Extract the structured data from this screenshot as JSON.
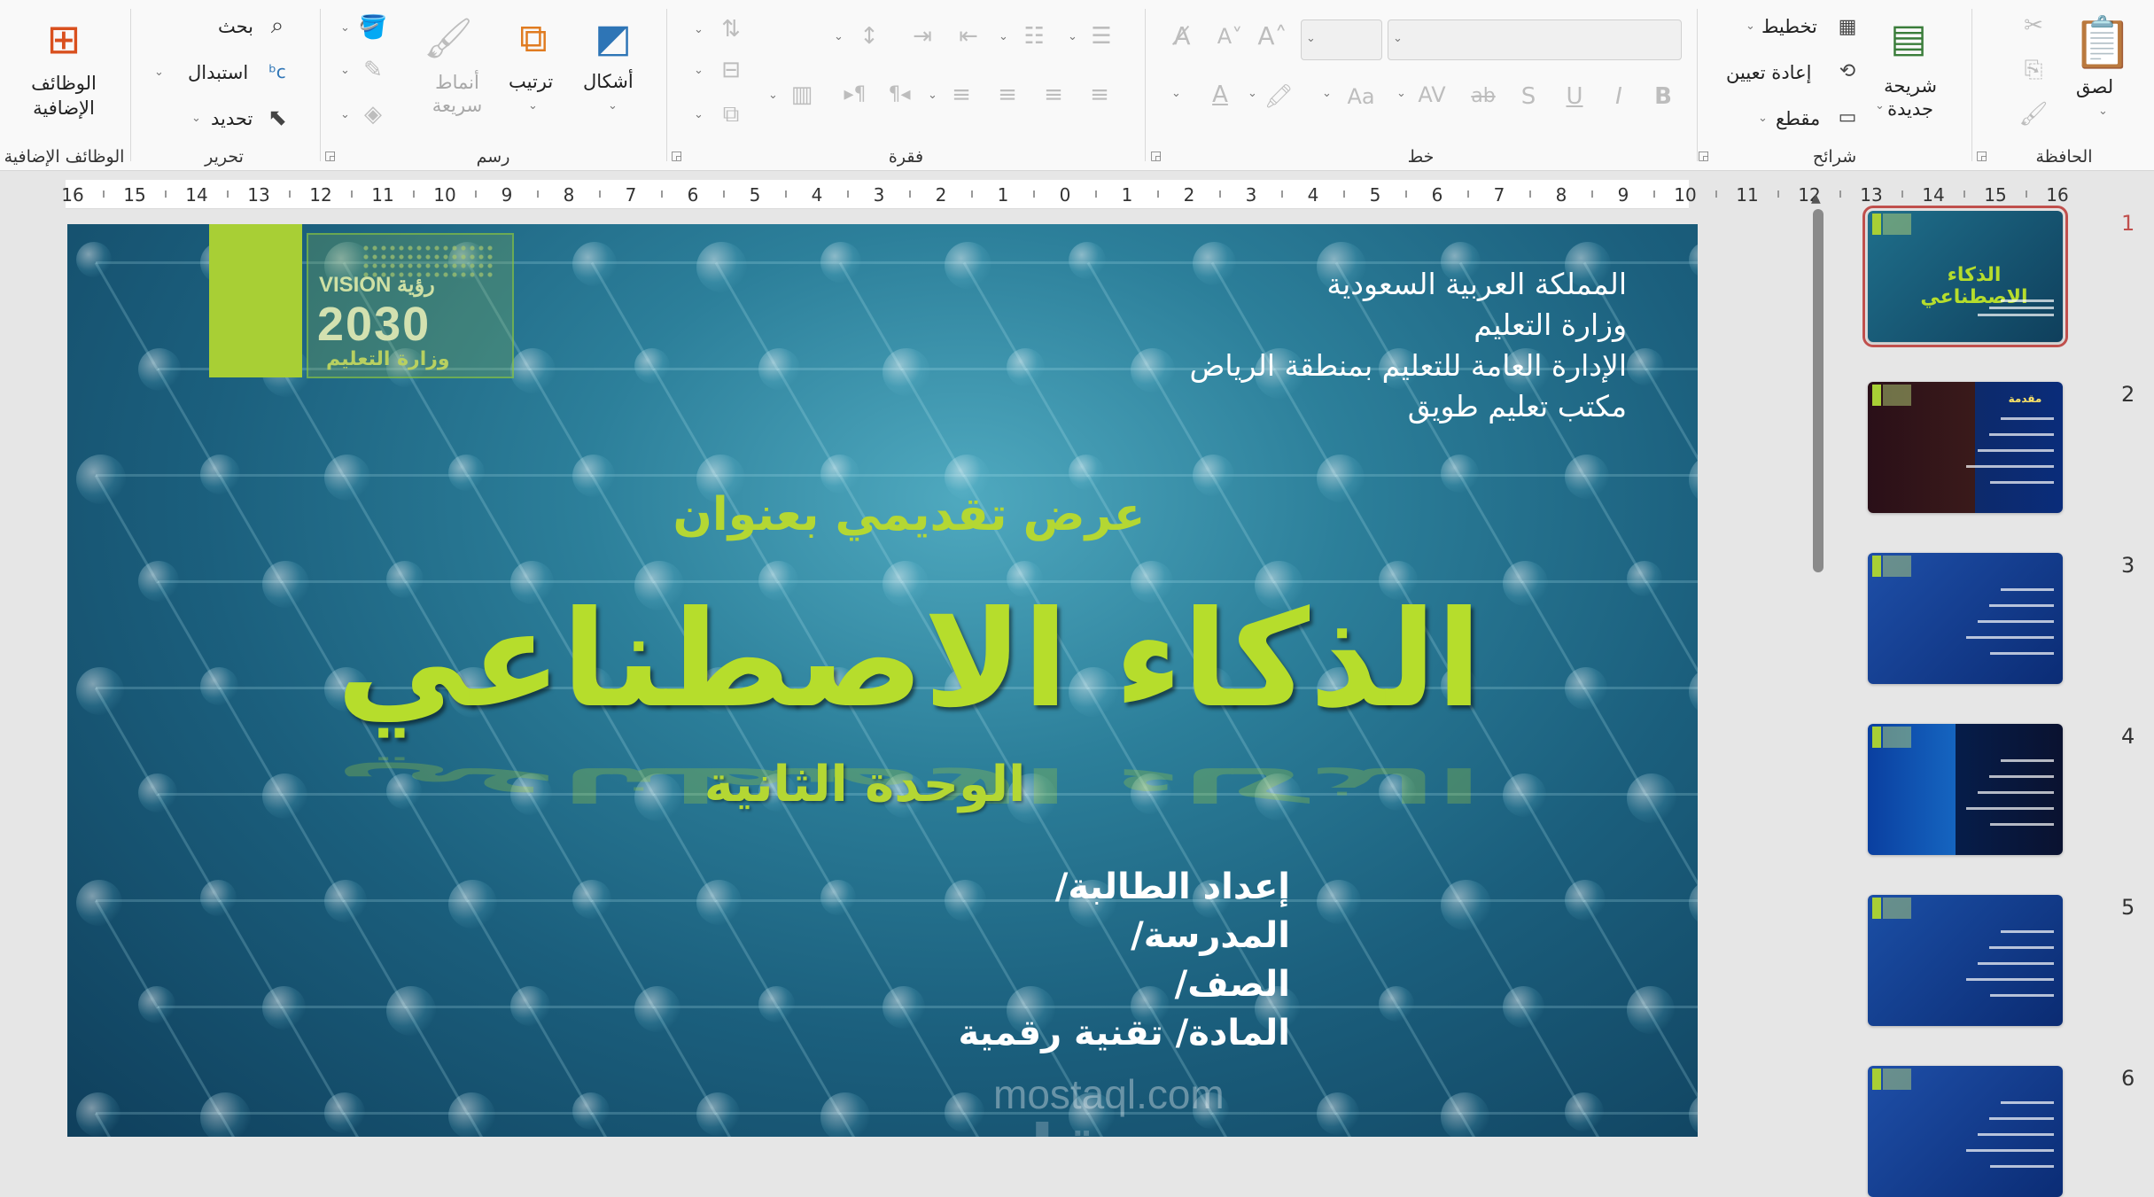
{
  "ribbon": {
    "clipboard": {
      "label": "الحافظة",
      "paste": "لصق"
    },
    "slides": {
      "label": "شرائح",
      "new_slide": "شريحة جديدة",
      "layout": "تخطيط",
      "reset": "إعادة تعيين",
      "section": "مقطع"
    },
    "font": {
      "label": "خط",
      "bold": "B",
      "italic": "I",
      "underline": "U",
      "shadow": "S",
      "strike": "ab",
      "spacing": "AV",
      "case": "Aa",
      "grow": "A^",
      "shrink": "A˅",
      "clear": "A"
    },
    "paragraph": {
      "label": "فقرة"
    },
    "drawing": {
      "label": "رسم",
      "shapes": "أشكال",
      "arrange": "ترتيب",
      "quick_styles": "أنماط سريعة"
    },
    "editing": {
      "label": "تحرير",
      "find": "بحث",
      "replace": "استبدال",
      "select": "تحديد"
    },
    "addins": {
      "label": "الوظائف الإضافية",
      "button": "الوظائف الإضافية"
    }
  },
  "ruler": {
    "ticks": [
      "16",
      "15",
      "14",
      "13",
      "12",
      "11",
      "10",
      "9",
      "8",
      "7",
      "6",
      "5",
      "4",
      "3",
      "2",
      "1",
      "0",
      "1",
      "2",
      "3",
      "4",
      "5",
      "6",
      "7",
      "8",
      "9",
      "10",
      "11",
      "12",
      "13",
      "14",
      "15",
      "16"
    ]
  },
  "slide": {
    "header_lines": [
      "المملكة العربية السعودية",
      "وزارة التعليم",
      "الإدارة العامة للتعليم بمنطقة الرياض",
      "مكتب تعليم طويق"
    ],
    "logo": {
      "vision": "VISION رؤية",
      "year": "2030",
      "ministry": "وزارة التعليم"
    },
    "subtitle": "عرض تقديمي بعنوان",
    "title": "الذكاء الاصطناعي",
    "unit": "الوحدة الثانية",
    "info": [
      "إعداد الطالبة/",
      "المدرسة/",
      "الصف/",
      "المادة/ تقنية رقمية"
    ],
    "watermark_ar": "مستقل",
    "watermark_en": "mostaql.com"
  },
  "thumbnails": {
    "numbers": [
      "1",
      "2",
      "3",
      "4",
      "5",
      "6"
    ],
    "selected_index": 1,
    "titles": [
      "الذكاء الاصطناعي",
      "مقدمة",
      "",
      "",
      "",
      ""
    ]
  },
  "colors": {
    "accent_green": "#a8cf35",
    "title_green": "#b6dd2c",
    "selection_red": "#c0504d"
  }
}
